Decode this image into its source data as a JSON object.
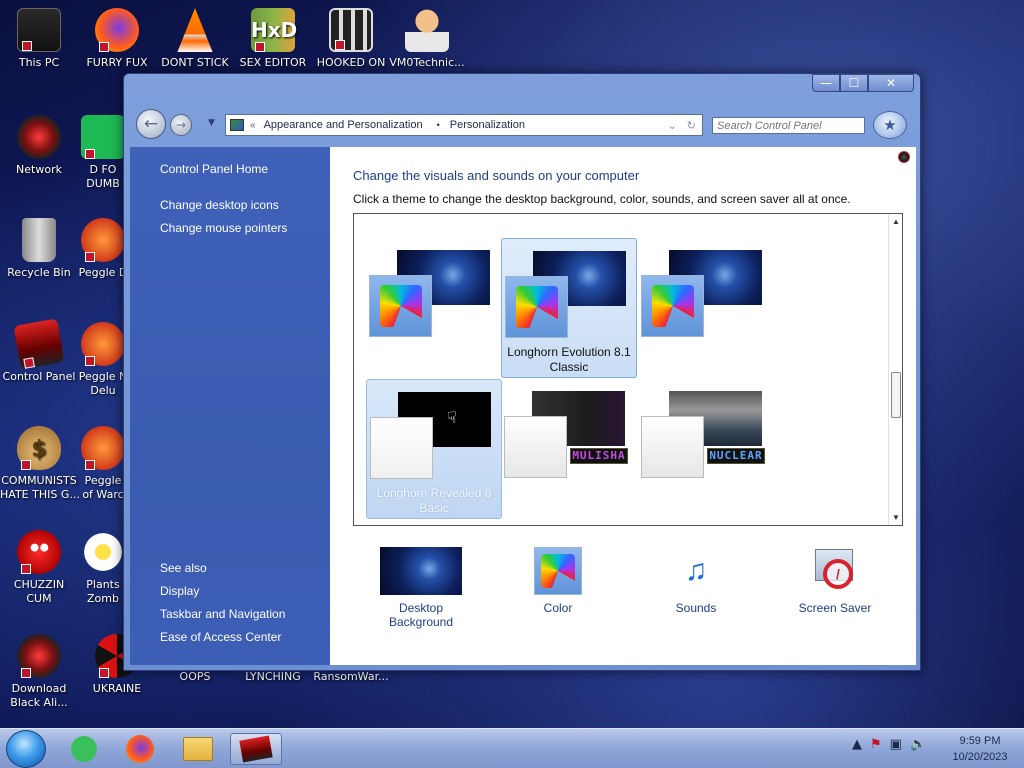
{
  "desktop": {
    "icons": [
      {
        "label": "This PC"
      },
      {
        "label": "FURRY FUX"
      },
      {
        "label": "DONT STICK"
      },
      {
        "label": "SEX EDITOR"
      },
      {
        "label": "HOOKED ON"
      },
      {
        "label": "VM0Technic..."
      },
      {
        "label": "Network"
      },
      {
        "label": "D FO\nDUMB"
      },
      {
        "label": "Recycle Bin"
      },
      {
        "label": "Peggle D"
      },
      {
        "label": "Control Panel"
      },
      {
        "label": "Peggle N\nDelu"
      },
      {
        "label": "COMMUNISTS\nHATE THIS G..."
      },
      {
        "label": "Peggle\nof Warc"
      },
      {
        "label": "CHUZZIN\nCUM"
      },
      {
        "label": "Plants\nZomb"
      },
      {
        "label": "Download\nBlack Ali..."
      },
      {
        "label": "UKRAINE"
      },
      {
        "label": "OOPS"
      },
      {
        "label": "LYNCHING"
      },
      {
        "label": "RansomWar..."
      }
    ]
  },
  "window": {
    "buttons": {
      "minimize": "—",
      "maximize": "☐",
      "close": "✕"
    },
    "address": {
      "chevron": "«",
      "segment1": "Appearance and Personalization",
      "separator": "•",
      "segment2": "Personalization"
    },
    "search_placeholder": "Search Control Panel"
  },
  "sidebar": {
    "home": "Control Panel Home",
    "links": [
      "Change desktop icons",
      "Change mouse pointers"
    ],
    "see_also_title": "See also",
    "see_also": [
      "Display",
      "Taskbar and Navigation",
      "Ease of Access Center"
    ]
  },
  "content": {
    "heading": "Change the visuals and sounds on your computer",
    "subheading": "Click a theme to change the desktop background, color, sounds, and screen saver all at once.",
    "themes": [
      {
        "name": ""
      },
      {
        "name": "Longhorn Evolution 8.1 Classic",
        "selected": true
      },
      {
        "name": ""
      },
      {
        "name": "Longhorn Revealed 8 Basic"
      },
      {
        "name": "",
        "tag": "MULISHA"
      },
      {
        "name": "",
        "tag": "NUCLEAR"
      }
    ],
    "bottom": [
      {
        "label": "Desktop Background"
      },
      {
        "label": "Color"
      },
      {
        "label": "Sounds"
      },
      {
        "label": "Screen Saver"
      }
    ]
  },
  "taskbar": {
    "clock_time": "9:59 PM",
    "clock_date": "10/20/2023"
  },
  "colors": {
    "accent": "#1f3f8a",
    "sidebar": "#3f61b8",
    "selection": "#c9ddf5"
  }
}
